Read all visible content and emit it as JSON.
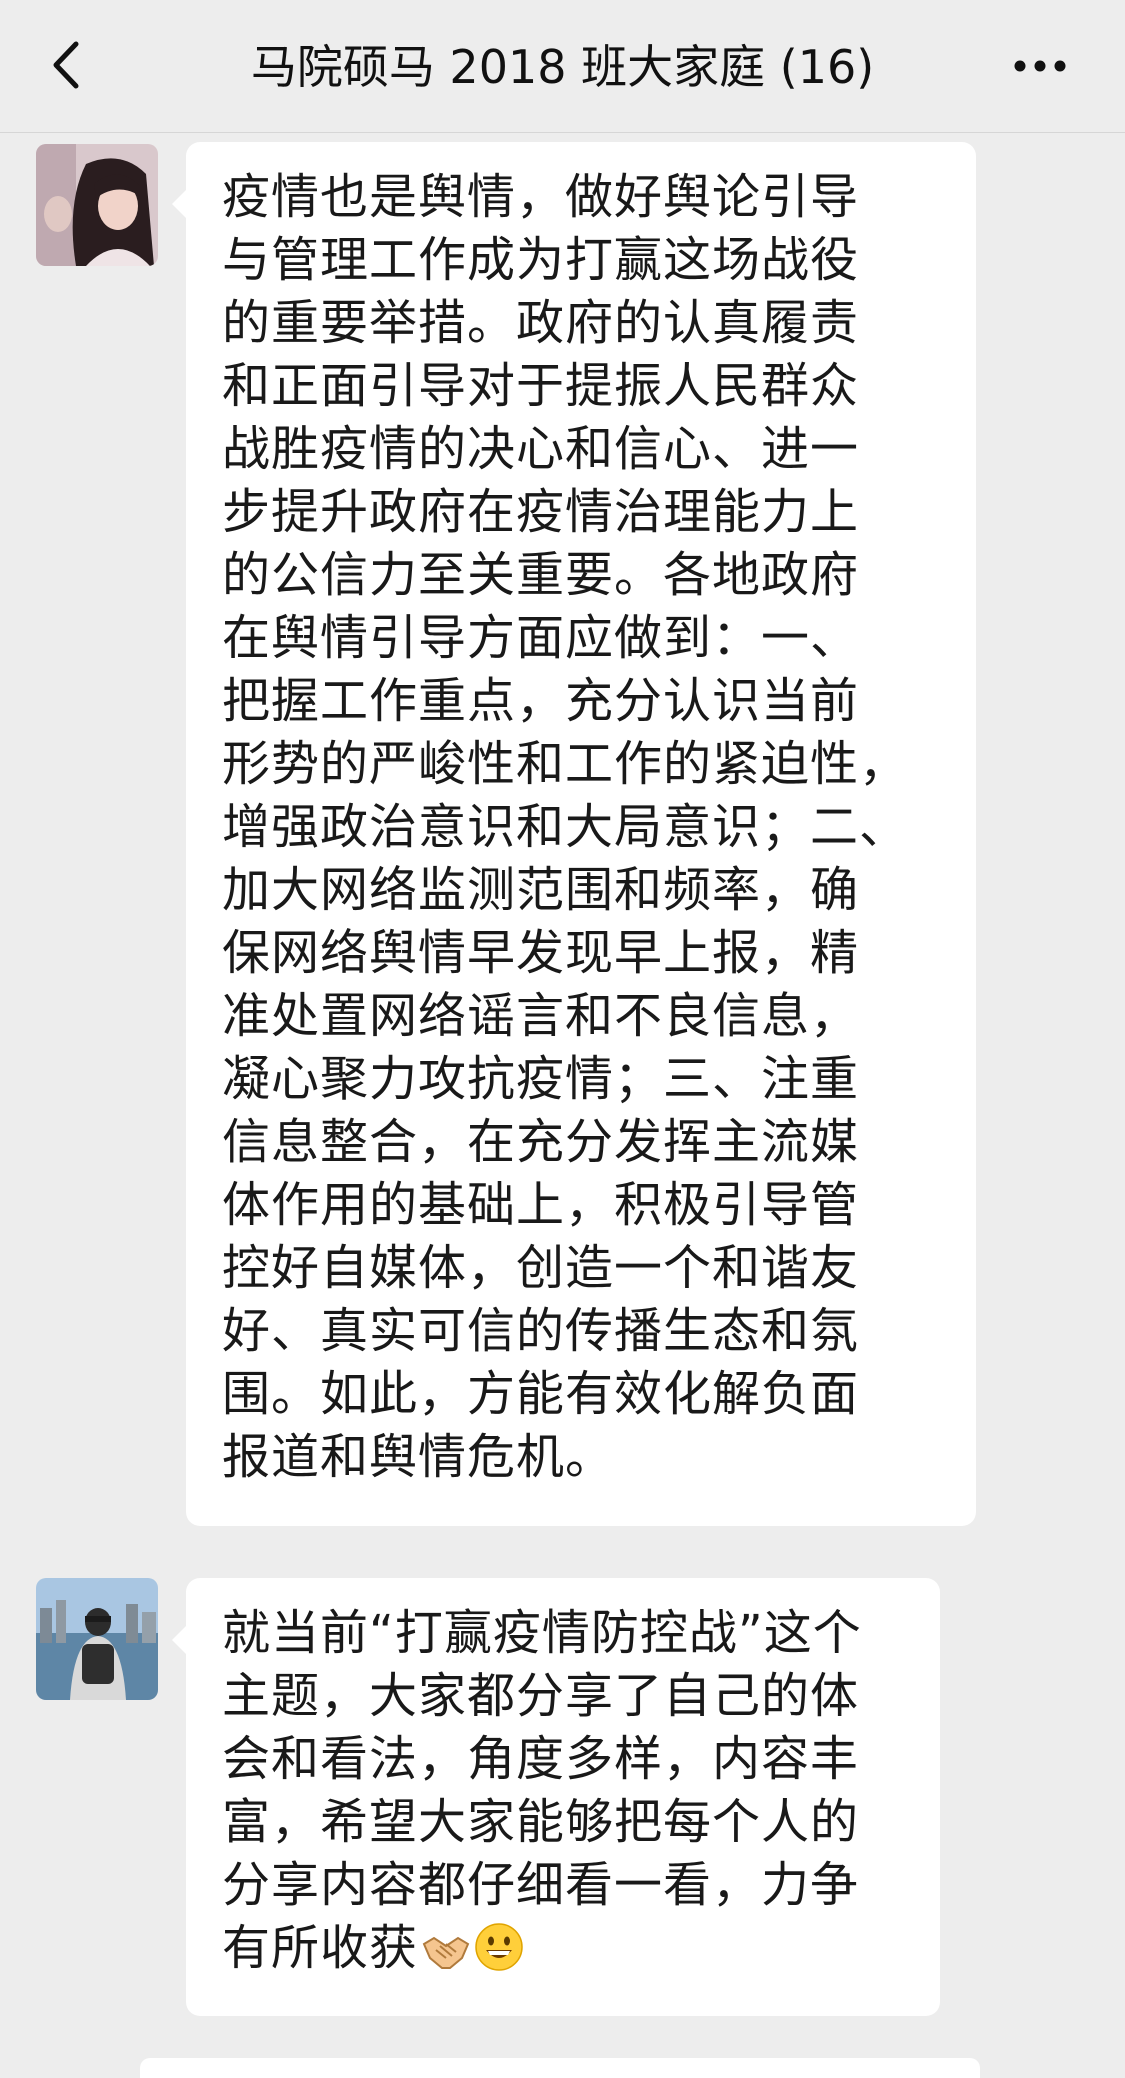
{
  "chat": {
    "title": "马院硕马 2018 班大家庭 (16)"
  },
  "messages": [
    {
      "sender_avatar": "avatar-girl-photo",
      "lines": [
        "疫情也是舆情，做好舆论引导",
        "与管理工作成为打赢这场战役",
        "的重要举措。政府的认真履责",
        "和正面引导对于提振人民群众",
        "战胜疫情的决心和信心、进一",
        "步提升政府在疫情治理能力上",
        "的公信力至关重要。各地政府",
        "在舆情引导方面应做到：一、",
        "把握工作重点，充分认识当前",
        "形势的严峻性和工作的紧迫性，",
        "增强政治意识和大局意识；二、",
        "加大网络监测范围和频率，确",
        "保网络舆情早发现早上报，精",
        "准处置网络谣言和不良信息，",
        "凝心聚力攻抗疫情；三、注重",
        "信息整合，在充分发挥主流媒",
        "体作用的基础上，积极引导管",
        "控好自媒体，创造一个和谐友",
        "好、真实可信的传播生态和氛",
        "围。如此，方能有效化解负面",
        "报道和舆情危机。"
      ]
    },
    {
      "sender_avatar": "avatar-city-backpack-photo",
      "lines": [
        "就当前“打赢疫情防控战”这个",
        "主题，大家都分享了自己的体",
        "会和看法，角度多样，内容丰",
        "富，希望大家能够把每个人的",
        "分享内容都仔细看一看，力争",
        "有所收获"
      ],
      "emojis": [
        "handshake-emoji",
        "grinning-face-emoji"
      ]
    }
  ],
  "colors": {
    "background": "#ededed",
    "bubble": "#ffffff",
    "text": "#191919"
  }
}
